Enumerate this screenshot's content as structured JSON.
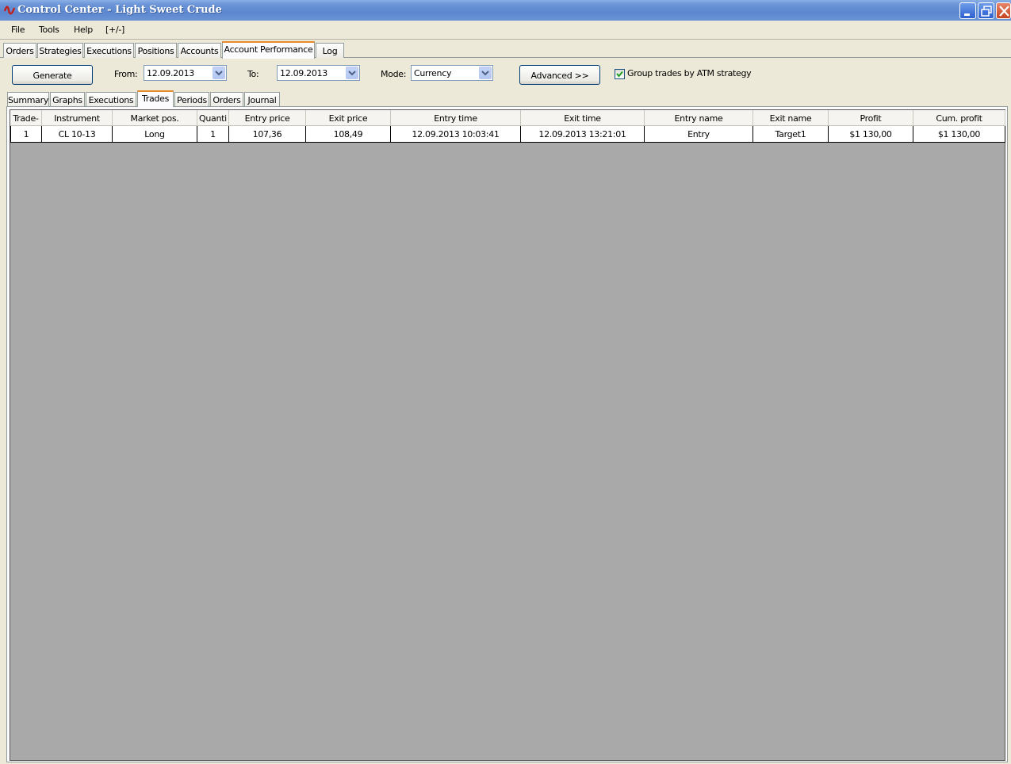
{
  "window": {
    "title": "Control Center - Light Sweet Crude"
  },
  "menu": [
    "File",
    "Tools",
    "Help",
    "[+/-]"
  ],
  "top_tabs": [
    "Orders",
    "Strategies",
    "Executions",
    "Positions",
    "Accounts",
    "Account Performance",
    "Log"
  ],
  "top_tabs_active": "Account Performance",
  "toolbar": {
    "generate_label": "Generate",
    "from_label": "From:",
    "from_value": "12.09.2013",
    "to_label": "To:",
    "to_value": "12.09.2013",
    "mode_label": "Mode:",
    "mode_value": "Currency",
    "advanced_label": "Advanced >>",
    "group_checkbox_label": "Group trades by ATM strategy",
    "group_checked": true
  },
  "sub_tabs": [
    "Summary",
    "Graphs",
    "Executions",
    "Trades",
    "Periods",
    "Orders",
    "Journal"
  ],
  "sub_tabs_active": "Trades",
  "table": {
    "columns": [
      "Trade-",
      "Instrument",
      "Market pos.",
      "Quanti",
      "Entry price",
      "Exit price",
      "Entry time",
      "Exit time",
      "Entry name",
      "Exit name",
      "Profit",
      "Cum. profit"
    ],
    "rows": [
      [
        "1",
        "CL 10-13",
        "Long",
        "1",
        "107,36",
        "108,49",
        "12.09.2013 10:03:41",
        "12.09.2013 13:21:01",
        "Entry",
        "Target1",
        "$1 130,00",
        "$1 130,00"
      ]
    ]
  }
}
